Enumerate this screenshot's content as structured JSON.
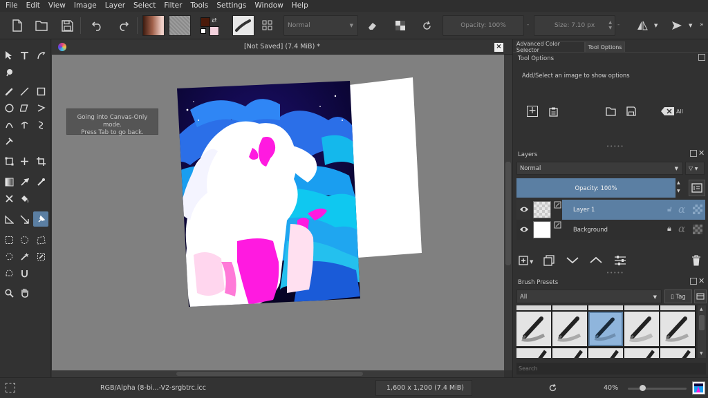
{
  "menubar": {
    "items": [
      "File",
      "Edit",
      "View",
      "Image",
      "Layer",
      "Select",
      "Filter",
      "Tools",
      "Settings",
      "Window",
      "Help"
    ]
  },
  "toolbar": {
    "blend_mode": "Normal",
    "opacity_label": "Opacity: 100%",
    "size_label": "Size: 7.10 px"
  },
  "document": {
    "title": "[Not Saved]  (7.4 MiB) *",
    "osd_line1": "Going into Canvas-Only mode.",
    "osd_line2": "Press Tab to go back."
  },
  "dock": {
    "tab_color_selector": "Advanced Color Selector",
    "tab_tool_options": "Tool Options",
    "tool_options_title": "Tool Options",
    "tool_options_hint": "Add/Select an image to show options",
    "all_label": "All",
    "layers_title": "Layers",
    "layers_blend": "Normal",
    "layers_opacity": "Opacity:  100%",
    "layers": [
      {
        "name": "Layer 1",
        "selected": true
      },
      {
        "name": "Background",
        "selected": false
      }
    ],
    "brush_title": "Brush Presets",
    "brush_filter": "All",
    "brush_tag": "Tag",
    "brush_search_placeholder": "Search"
  },
  "status": {
    "color_space": "RGB/Alpha (8-bi...-V2-srgbtrc.icc",
    "image_size": "1,600 x 1,200 (7.4 MiB)",
    "zoom": "40%"
  },
  "colors": {
    "accent": "#5b7fa3",
    "foreground": "#4a1a0a",
    "background": "#f2d0dc",
    "canvas_bg": "#808080"
  }
}
